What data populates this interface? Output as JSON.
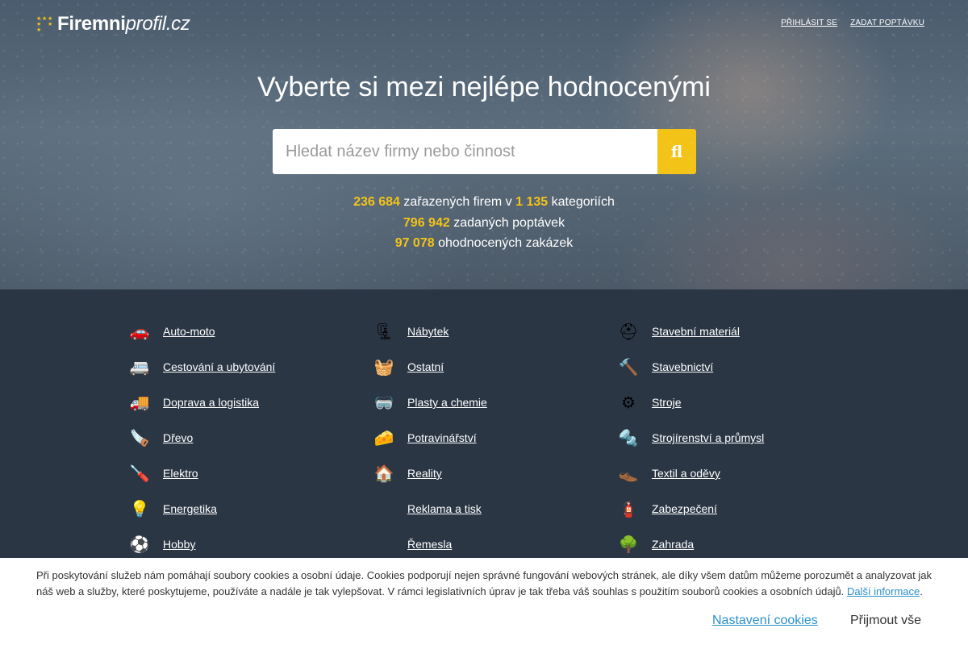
{
  "header": {
    "logo_bold": "Firemni",
    "logo_light": "profil.cz",
    "login_label": "PŘIHLÁSIT SE",
    "request_label": "ZADAT POPTÁVKU"
  },
  "hero": {
    "headline": "Vyberte si mezi nejlépe hodnocenými",
    "search_placeholder": "Hledat název firmy nebo činnost",
    "search_button_glyph": "fl"
  },
  "stats": {
    "companies": "236 684",
    "companies_text": "zařazených firem v",
    "categories": "1 135",
    "categories_text": "kategoriích",
    "requests": "796 942",
    "requests_text": "zadaných poptávek",
    "rated": "97 078",
    "rated_text": "ohodnocených zakázek"
  },
  "categories": [
    {
      "label": "Auto-moto",
      "icon": "car-icon",
      "glyph": "🚗"
    },
    {
      "label": "Nábytek",
      "icon": "clamp-icon",
      "glyph": "🗜"
    },
    {
      "label": "Stavební materiál",
      "icon": "hardhat-icon",
      "glyph": "⛑"
    },
    {
      "label": "Cestování a ubytování",
      "icon": "camper-icon",
      "glyph": "🚐"
    },
    {
      "label": "Ostatní",
      "icon": "basket-icon",
      "glyph": "🧺"
    },
    {
      "label": "Stavebnictví",
      "icon": "hammer-icon",
      "glyph": "🔨"
    },
    {
      "label": "Doprava a logistika",
      "icon": "truck-icon",
      "glyph": "🚚"
    },
    {
      "label": "Plasty a chemie",
      "icon": "goggles-icon",
      "glyph": "🥽"
    },
    {
      "label": "Stroje",
      "icon": "gears-icon",
      "glyph": "⚙"
    },
    {
      "label": "Dřevo",
      "icon": "saw-icon",
      "glyph": "🪚"
    },
    {
      "label": "Potravinářství",
      "icon": "cheese-icon",
      "glyph": "🧀"
    },
    {
      "label": "Strojírenství a průmysl",
      "icon": "screws-icon",
      "glyph": "🔩"
    },
    {
      "label": "Elektro",
      "icon": "screwdrivers-icon",
      "glyph": "🪛"
    },
    {
      "label": "Reality",
      "icon": "house-icon",
      "glyph": "🏠"
    },
    {
      "label": "Textil a oděvy",
      "icon": "shoe-icon",
      "glyph": "👞"
    },
    {
      "label": "Energetika",
      "icon": "bulb-icon",
      "glyph": "💡"
    },
    {
      "label": "Reklama a tisk",
      "icon": "",
      "glyph": ""
    },
    {
      "label": "Zabezpečení",
      "icon": "extinguisher-icon",
      "glyph": "🧯"
    },
    {
      "label": "Hobby",
      "icon": "ball-icon",
      "glyph": "⚽"
    },
    {
      "label": "Řemesla",
      "icon": "",
      "glyph": ""
    },
    {
      "label": "Zahrada",
      "icon": "bonsai-icon",
      "glyph": "🌳"
    }
  ],
  "cookie": {
    "text": "Při poskytování služeb nám pomáhají soubory cookies a osobní údaje. Cookies podporují nejen správné fungování webových stránek, ale díky všem datům můžeme porozumět a analyzovat jak náš web a služby, které poskytujeme, používáte a nadále je tak vylepšovat. V rámci legislativních úprav je tak třeba váš souhlas s použitím souborů cookies a osobních údajů.",
    "more_link": "Další informace",
    "settings_label": "Nastavení cookies",
    "accept_label": "Přijmout vše"
  },
  "colors": {
    "accent": "#f3c317",
    "link_blue": "#2a8fc9",
    "bg_dark": "#2a3644"
  }
}
